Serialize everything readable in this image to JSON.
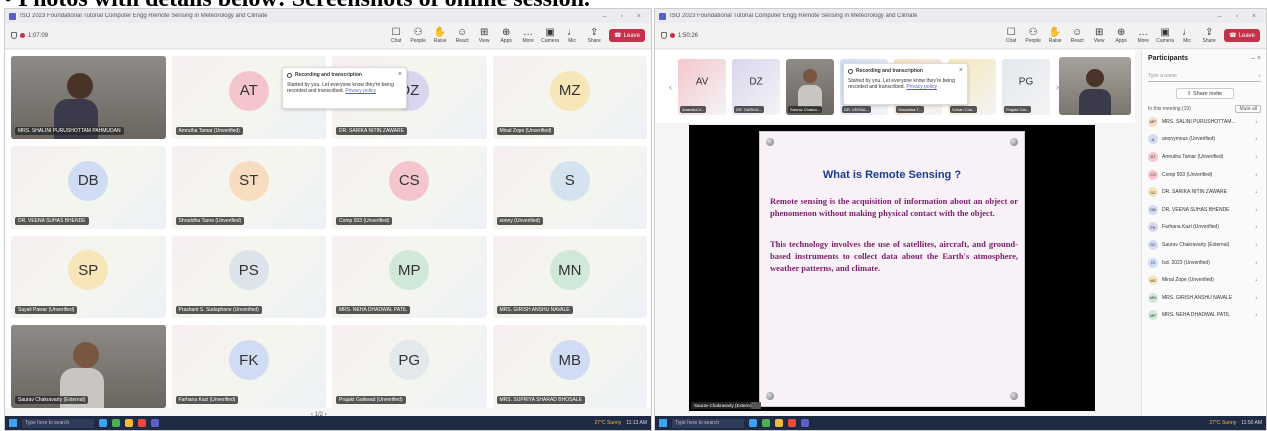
{
  "page_heading": "• Photos with details below: Screenshots of online session.",
  "left": {
    "window_title": "ISO 2023 Foundational Tutorial Computer Engg Remote Sensing in Meteorology and Climate",
    "timer": "1:07:09",
    "toolbar": [
      {
        "label": "Chat",
        "icon": "chat-icon",
        "glyph": "☐"
      },
      {
        "label": "People",
        "icon": "people-icon",
        "glyph": "⚇"
      },
      {
        "label": "Raise",
        "icon": "raise-hand-icon",
        "glyph": "✋"
      },
      {
        "label": "React",
        "icon": "react-icon",
        "glyph": "☺"
      },
      {
        "label": "View",
        "icon": "view-icon",
        "glyph": "⊞"
      },
      {
        "label": "Apps",
        "icon": "apps-icon",
        "glyph": "⊕"
      },
      {
        "label": "More",
        "icon": "more-icon",
        "glyph": "…"
      },
      {
        "label": "Camera",
        "icon": "camera-icon",
        "glyph": "▣"
      },
      {
        "label": "Mic",
        "icon": "mic-icon",
        "glyph": "♩"
      },
      {
        "label": "Share",
        "icon": "share-icon",
        "glyph": "⇪"
      }
    ],
    "leave_label": "Leave",
    "popup": {
      "title": "Recording and transcription",
      "body": "Started by you. Let everyone know they're being recorded and transcribed.",
      "link": "Privacy policy"
    },
    "tiles": [
      {
        "initials": "",
        "name": "MRS. SHALINI PURUSHOTTAM PAHMUDAN",
        "video": "f",
        "color": ""
      },
      {
        "initials": "AT",
        "name": "Amrutha Tamar (Unverified)",
        "video": "",
        "color": "#f4c6cc"
      },
      {
        "initials": "DZ",
        "name": "DR. SARIKA NITIN ZAWARE",
        "video": "",
        "color": "#d9d5ee"
      },
      {
        "initials": "MZ",
        "name": "Minal Zope (Unverified)",
        "video": "",
        "color": "#f6e6b8"
      },
      {
        "initials": "DB",
        "name": "DR. VEENA SUHAS BHENDE",
        "video": "",
        "color": "#cfdcf3"
      },
      {
        "initials": "ST",
        "name": "Shraddha Tarne (Unverified)",
        "video": "",
        "color": "#f8dcc0"
      },
      {
        "initials": "CS",
        "name": "Comp 503 (Unverified)",
        "video": "",
        "color": "#f4c6cc"
      },
      {
        "initials": "S",
        "name": "sonny (Unverified)",
        "video": "",
        "color": "#d5e2ef"
      },
      {
        "initials": "SP",
        "name": "Sayali Pawar (Unverified)",
        "video": "",
        "color": "#f6e6b8"
      },
      {
        "initials": "PS",
        "name": "Prashant S. Sudaphane (Unverified)",
        "video": "",
        "color": "#dde3ea"
      },
      {
        "initials": "MP",
        "name": "MRS. NEHA DHADWAL PATIL",
        "video": "",
        "color": "#cfe8d8"
      },
      {
        "initials": "MN",
        "name": "MRS. GIRISH ANSHU NAVALE",
        "video": "",
        "color": "#cfe8d8"
      },
      {
        "initials": "",
        "name": "Saurav Chakravarty (External)",
        "video": "m",
        "color": ""
      },
      {
        "initials": "FK",
        "name": "Farhana Kazi (Unverified)",
        "video": "",
        "color": "#cfdcf3"
      },
      {
        "initials": "PG",
        "name": "Prajakt Gaikwad (Unverified)",
        "video": "",
        "color": "#e3e8ec"
      },
      {
        "initials": "MB",
        "name": "MRS. SUPRIYA SHARAD BHOSALE",
        "video": "",
        "color": "#cfdcf3"
      }
    ],
    "pager": "1/2",
    "taskbar": {
      "search": "Type here to search",
      "weather": "27°C Sunny",
      "clock": "11:13 AM"
    }
  },
  "right": {
    "window_title": "ISO 2023 Foundational Tutorial Computer Engg Remote Sensing in Meteorology and Climate",
    "timer": "1:50:26",
    "toolbar": [
      {
        "label": "Chat",
        "icon": "chat-icon",
        "glyph": "☐"
      },
      {
        "label": "People",
        "icon": "people-icon",
        "glyph": "⚇"
      },
      {
        "label": "Raise",
        "icon": "raise-hand-icon",
        "glyph": "✋"
      },
      {
        "label": "React",
        "icon": "react-icon",
        "glyph": "☺"
      },
      {
        "label": "View",
        "icon": "view-icon",
        "glyph": "⊞"
      },
      {
        "label": "Apps",
        "icon": "apps-icon",
        "glyph": "⊕"
      },
      {
        "label": "More",
        "icon": "more-icon",
        "glyph": "…"
      },
      {
        "label": "Camera",
        "icon": "camera-icon",
        "glyph": "▣"
      },
      {
        "label": "Mic",
        "icon": "mic-icon",
        "glyph": "♩"
      },
      {
        "label": "Share",
        "icon": "share-icon",
        "glyph": "⇪"
      }
    ],
    "leave_label": "Leave",
    "strip": [
      {
        "initials": "AV",
        "name": "Anamika V...",
        "video": false,
        "color": "#f4c6cc"
      },
      {
        "initials": "DZ",
        "name": "DR. SARIKA...",
        "video": false,
        "color": "#d9d5ee"
      },
      {
        "initials": "",
        "name": "Saurav Chakra...",
        "video": true,
        "color": ""
      },
      {
        "initials": "",
        "name": "DR. VEENA...",
        "video": false,
        "color": "#cfdcf3"
      },
      {
        "initials": "",
        "name": "Shraddha T...",
        "video": false,
        "color": "#f8dcc0"
      },
      {
        "initials": "",
        "name": "Sohan Cha...",
        "video": false,
        "color": "#f6e6b8"
      },
      {
        "initials": "PG",
        "name": "Prajakt Gai...",
        "video": false,
        "color": "#e3e8ec"
      }
    ],
    "popup": {
      "title": "Recording and transcription",
      "body": "Started by you. Let everyone know they're being recorded and transcribed.",
      "link": "Privacy policy"
    },
    "slide": {
      "title": "What is Remote Sensing ?",
      "p1": "Remote sensing is the acquisition of information about an object or phenomenon without making physical contact with the object.",
      "p2": "This technology involves the use of satellites, aircraft, and ground-based instruments to collect data about the Earth's atmosphere, weather patterns, and climate."
    },
    "presenter_tag": "Saurav Chakravarty (External)",
    "panel": {
      "title": "Participants",
      "search_placeholder": "Type a name",
      "share_invite": "Share invite",
      "section": "In this meeting (19)",
      "mute_all": "Mute all",
      "people": [
        {
          "initials": "MP",
          "name": "MRS. SALINI PURUSHOTTAM...",
          "color": "#f8dcc0"
        },
        {
          "initials": "A",
          "name": "anonymous (Unverified)",
          "color": "#cfdcf3"
        },
        {
          "initials": "AT",
          "name": "Amrutha Tamar (Unverified)",
          "color": "#f4c6cc"
        },
        {
          "initials": "CS",
          "name": "Comp 503 (Unverified)",
          "color": "#f4c6cc"
        },
        {
          "initials": "DZ",
          "name": "DR. SARIKA NITIN ZAWARE",
          "color": "#f6e6b8"
        },
        {
          "initials": "DB",
          "name": "DR. VEENA SUHAS BHENDE",
          "color": "#cfdcf3"
        },
        {
          "initials": "FK",
          "name": "Farhana Kazi (Unverified)",
          "color": "#d9d5ee"
        },
        {
          "initials": "SC",
          "name": "Saurav Chakravarty (External)",
          "color": "#cfdcf3"
        },
        {
          "initials": "IS",
          "name": "Isd. 2023 (Unverified)",
          "color": "#cfdcf3"
        },
        {
          "initials": "MZ",
          "name": "Minal Zope (Unverified)",
          "color": "#f6e6b8"
        },
        {
          "initials": "MN",
          "name": "MRS. GIRISH ANSHU NAVALE",
          "color": "#cfe8d8"
        },
        {
          "initials": "MP",
          "name": "MRS. NEHA DHADWAL PATIL",
          "color": "#cfe8d8"
        }
      ]
    },
    "taskbar": {
      "search": "Type here to search",
      "weather": "27°C Sunny",
      "clock": "11:50 AM"
    }
  }
}
